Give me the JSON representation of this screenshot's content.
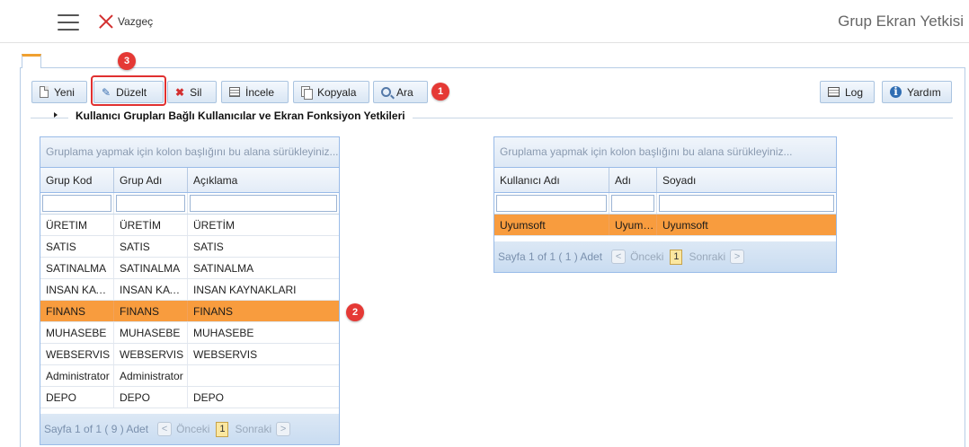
{
  "header": {
    "cancel_label": "Vazgeç",
    "title": "Grup Ekran Yetkisi"
  },
  "toolbar": {
    "new_label": "Yeni",
    "edit_label": "Düzelt",
    "delete_label": "Sil",
    "inspect_label": "İncele",
    "copy_label": "Kopyala",
    "search_label": "Ara",
    "log_label": "Log",
    "help_label": "Yardım"
  },
  "markers": [
    "1",
    "2",
    "3"
  ],
  "section": {
    "title": "Kullanıcı Grupları Bağlı Kullanıcılar ve Ekran Fonksiyon Yetkileri"
  },
  "groups_grid": {
    "group_hint": "Gruplama yapmak için kolon başlığını bu alana sürükleyiniz...",
    "columns": [
      "Grup Kod",
      "Grup Adı",
      "Açıklama"
    ],
    "rows": [
      [
        "ÜRETIM",
        "ÜRETİM",
        "ÜRETİM"
      ],
      [
        "SATIS",
        "SATIS",
        "SATIS"
      ],
      [
        "SATINALMA",
        "SATINALMA",
        "SATINALMA"
      ],
      [
        "INSAN KAYNAKLARI",
        "INSAN KAYNAKLARI",
        "INSAN KAYNAKLARI"
      ],
      [
        "FINANS",
        "FINANS",
        "FINANS"
      ],
      [
        "MUHASEBE",
        "MUHASEBE",
        "MUHASEBE"
      ],
      [
        "WEBSERVIS",
        "WEBSERVIS",
        "WEBSERVIS"
      ],
      [
        "Administrator",
        "Administrator",
        ""
      ],
      [
        "DEPO",
        "DEPO",
        "DEPO"
      ]
    ],
    "selected_row": 4,
    "pager": {
      "info": "Sayfa 1 of 1 ( 9 ) Adet",
      "prev": "Önceki",
      "page": "1",
      "next": "Sonraki"
    }
  },
  "users_grid": {
    "group_hint": "Gruplama yapmak için kolon başlığını bu alana sürükleyiniz...",
    "columns": [
      "Kullanıcı Adı",
      "Adı",
      "Soyadı"
    ],
    "rows": [
      [
        "Uyumsoft",
        "Uyumsoft",
        "Uyumsoft"
      ]
    ],
    "selected_row": 0,
    "pager": {
      "info": "Sayfa 1 of 1 ( 1 ) Adet",
      "prev": "Önceki",
      "page": "1",
      "next": "Sonraki"
    }
  }
}
